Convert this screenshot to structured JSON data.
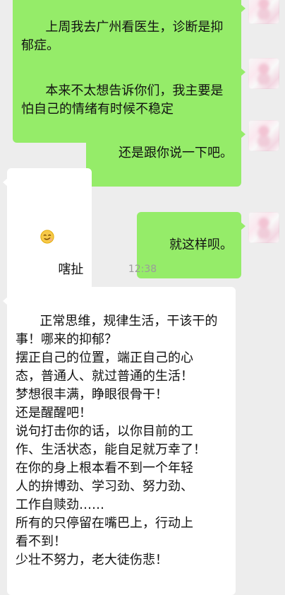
{
  "messages": [
    {
      "side": "right",
      "text": "上周我去广州看医生，诊断是抑\n郁症。"
    },
    {
      "side": "right",
      "text": "本来不太想告诉你们，我主要是\n怕自己的情绪有时候不稳定"
    },
    {
      "side": "right",
      "text": "还是跟你说一下吧。"
    },
    {
      "side": "left",
      "emoji": "smirk-face-icon",
      "text": "嗐扯"
    },
    {
      "side": "right",
      "text": "就这样呗。"
    },
    {
      "side": "left",
      "text": "正常思维，规律生活，干该干的\n事！哪来的抑郁？\n摆正自己的位置，端正自己的心\n态，普通人、就过普通的生活！\n梦想很丰满，睁眼很骨干！\n还是醒醒吧！\n说句打击你的话，以你目前的工\n作、生活状态，能自足就万幸了！\n在你的身上根本看不到一个年轻\n人的拚博劲、学习劲、努力劲、\n工作自赎劲……\n所有的只停留在嘴巴上，行动上\n看不到！\n少壮不努力，老大徒伤悲！"
    }
  ],
  "timestamp": "12:38",
  "colors": {
    "background": "#ededed",
    "bubble_green": "#95ec69",
    "bubble_white": "#ffffff",
    "timestamp": "#9b9b9b"
  }
}
